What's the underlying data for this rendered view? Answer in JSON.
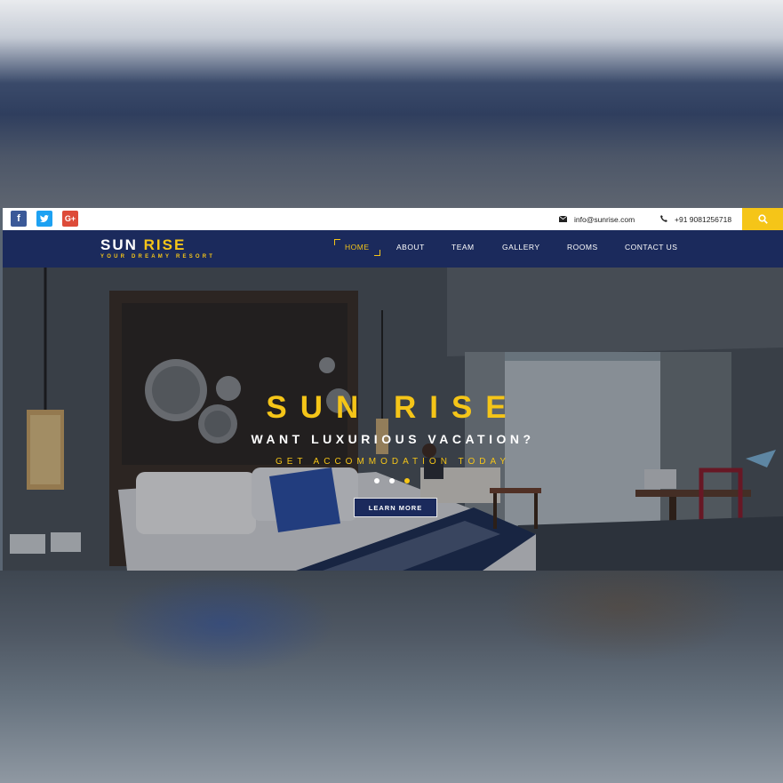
{
  "topbar": {
    "social": [
      {
        "name": "facebook",
        "glyph": "f",
        "color": "#3b5998"
      },
      {
        "name": "twitter",
        "glyph": "t",
        "color": "#1da1f2"
      },
      {
        "name": "google-plus",
        "glyph": "G+",
        "color": "#dd4b39"
      }
    ],
    "email": "info@sunrise.com",
    "phone": "+91 9081256718",
    "search_icon": "search-icon",
    "accent": "#f5c518"
  },
  "brand": {
    "name_main": "SUN",
    "name_accent": "RISE",
    "tagline": "YOUR DREAMY RESORT"
  },
  "nav": {
    "items": [
      "HOME",
      "ABOUT",
      "TEAM",
      "GALLERY",
      "ROOMS",
      "CONTACT US"
    ],
    "active": "HOME",
    "bar_color": "#1b2a5c"
  },
  "hero": {
    "title": "SUN RISE",
    "subtitle": "WANT LUXURIOUS VACATION?",
    "tagline": "GET ACCOMMODATION TODAY",
    "slides": 3,
    "active_slide": 3,
    "cta": "LEARN MORE"
  }
}
